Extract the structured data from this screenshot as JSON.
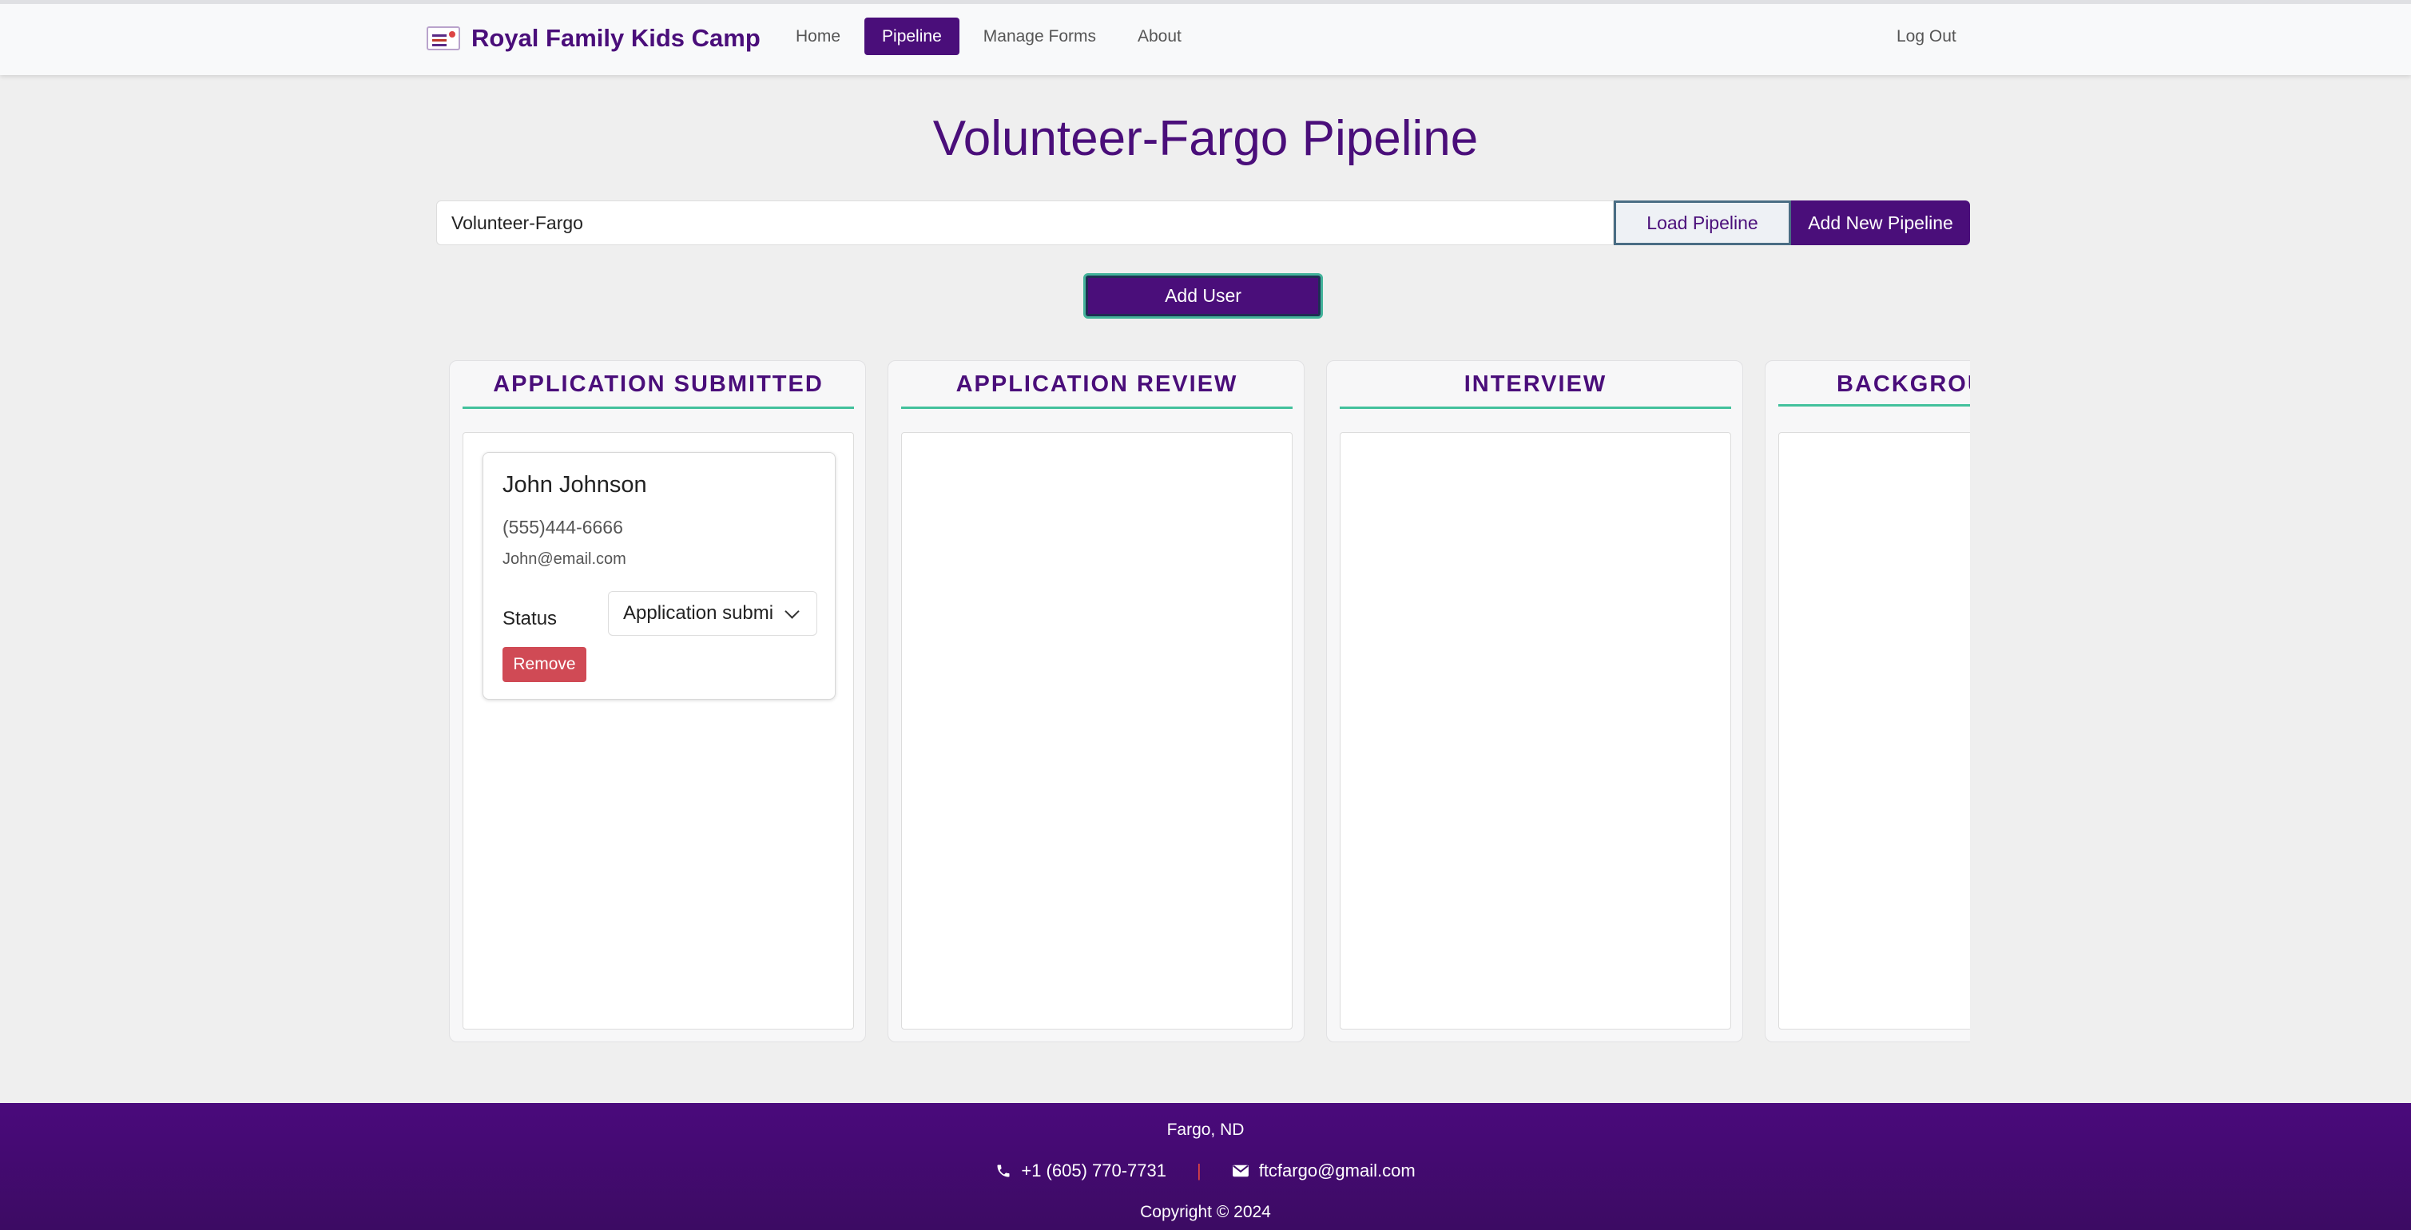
{
  "nav": {
    "brand": "Royal Family Kids Camp",
    "links": [
      "Home",
      "Pipeline",
      "Manage Forms",
      "About"
    ],
    "active": "Pipeline",
    "logout": "Log Out"
  },
  "page": {
    "title": "Volunteer-Fargo Pipeline"
  },
  "pipeline": {
    "input_value": "Volunteer-Fargo",
    "load_label": "Load Pipeline",
    "add_label": "Add New Pipeline",
    "add_user_label": "Add User"
  },
  "columns": [
    {
      "title": "APPLICATION SUBMITTED",
      "cards": [
        {
          "name": "John Johnson",
          "phone": "(555)444-6666",
          "email": "John@email.com",
          "status_label": "Status",
          "status_value": "Application submi",
          "remove_label": "Remove"
        }
      ]
    },
    {
      "title": "APPLICATION REVIEW",
      "cards": []
    },
    {
      "title": "INTERVIEW",
      "cards": []
    },
    {
      "title": "BACKGROU",
      "cards": []
    }
  ],
  "footer": {
    "location": "Fargo, ND",
    "phone": "+1 (605) 770-7731",
    "separator": "|",
    "email": "ftcfargo@gmail.com",
    "copyright": "Copyright © 2024"
  },
  "colors": {
    "brand_purple": "#4a0e7a",
    "accent_green": "#43c19c",
    "danger_red": "#d04a55"
  },
  "icons": [
    "logo-icon",
    "phone-icon",
    "mail-icon",
    "chevron-down-icon"
  ]
}
